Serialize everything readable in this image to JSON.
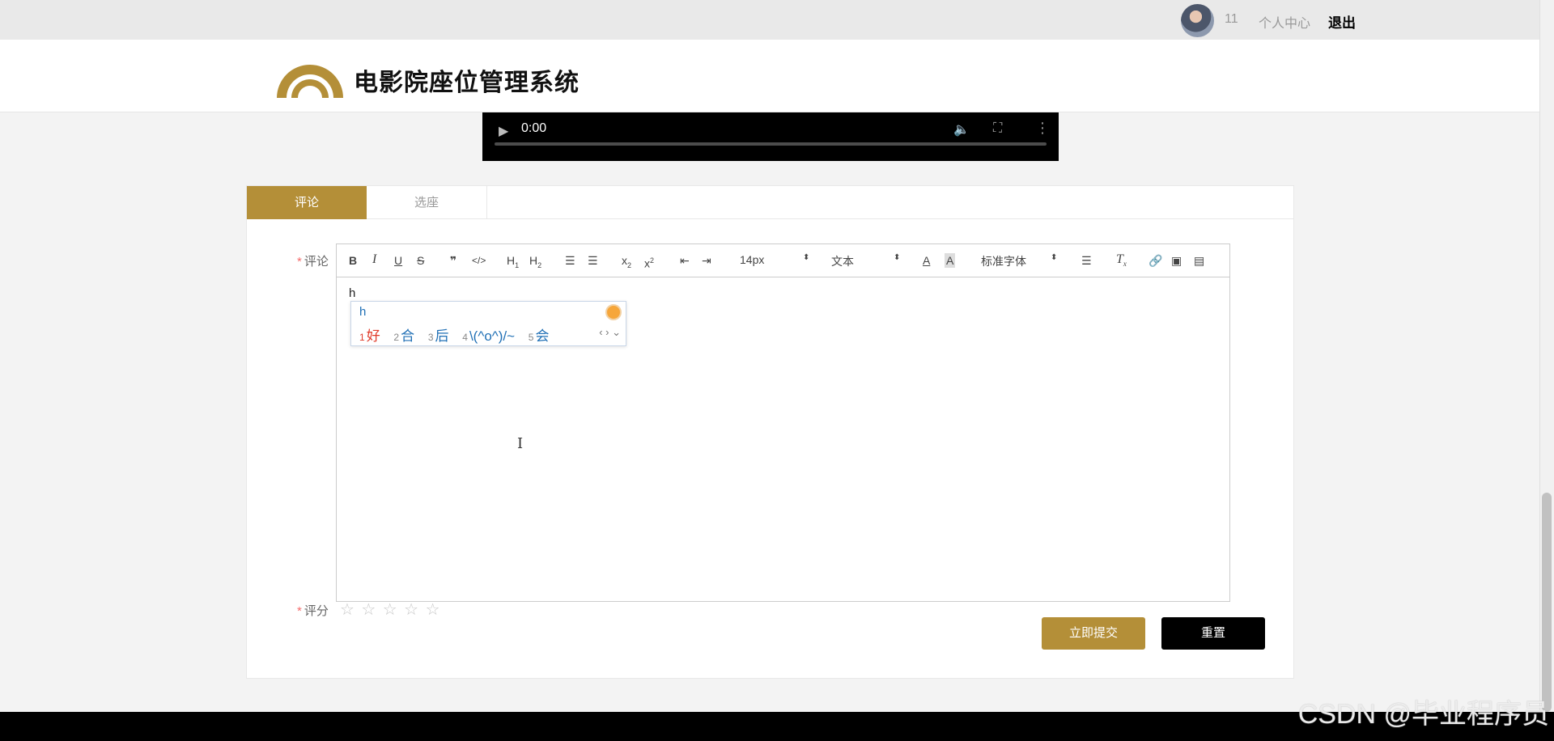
{
  "topbar": {
    "username": "11",
    "profile_label": "个人中心",
    "logout_label": "退出"
  },
  "header": {
    "title": "电影院座位管理系统"
  },
  "video": {
    "time": "0:00"
  },
  "tabs": [
    {
      "label": "评论"
    },
    {
      "label": "选座"
    }
  ],
  "form": {
    "comment_label": "评论",
    "rating_label": "评分",
    "required_mark": "*",
    "editor_text": "h",
    "toolbar": {
      "font_size": "14px",
      "header_select": "文本",
      "font_family": "标准字体"
    },
    "rating_value": 0,
    "rating_max": 5
  },
  "ime": {
    "input": "h",
    "candidates": [
      {
        "index": "1",
        "text": "好"
      },
      {
        "index": "2",
        "text": "合"
      },
      {
        "index": "3",
        "text": "后"
      },
      {
        "index": "4",
        "text": "\\(^o^)/~"
      },
      {
        "index": "5",
        "text": "会"
      }
    ]
  },
  "buttons": {
    "submit_label": "立即提交",
    "reset_label": "重置"
  },
  "watermark": "CSDN @毕业程序员",
  "colors": {
    "accent": "#b48f38",
    "reset": "#000000"
  }
}
